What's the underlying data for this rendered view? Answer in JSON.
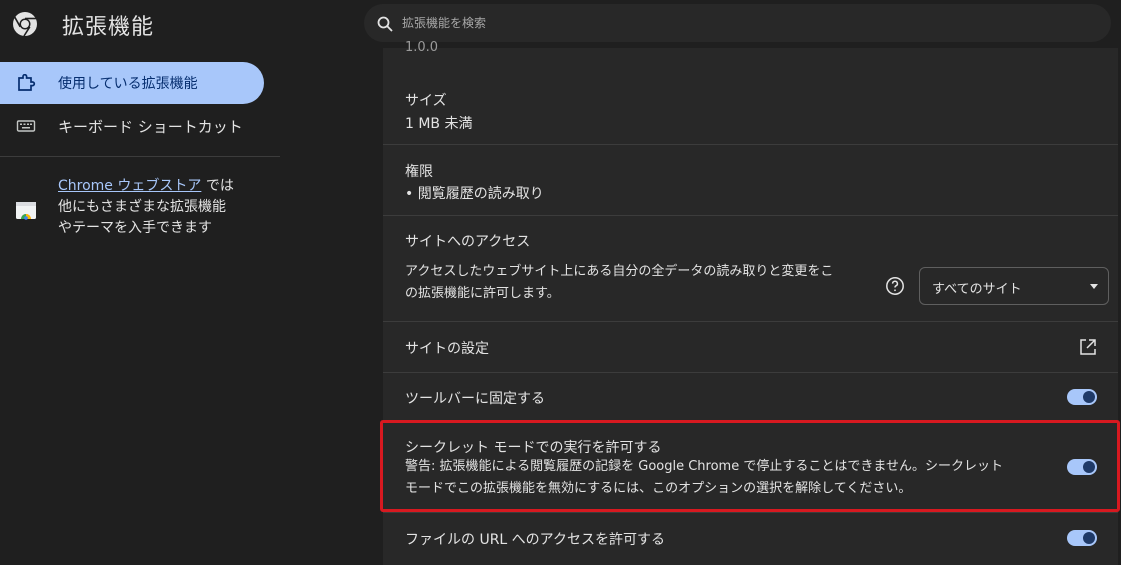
{
  "header": {
    "title": "拡張機能",
    "search_placeholder": "拡張機能を検索"
  },
  "sidebar": {
    "items": [
      {
        "label": "使用している拡張機能",
        "active": true,
        "icon": "extension-icon"
      },
      {
        "label": "キーボード ショートカット",
        "active": false,
        "icon": "keyboard-icon"
      }
    ],
    "store": {
      "link_text": "Chrome ウェブストア",
      "line1_suffix": " では",
      "line2": "他にもさまざまな拡張機能",
      "line3": "やテーマを入手できます",
      "icon": "chrome-web-store-icon"
    }
  },
  "details": {
    "version_fragment": "1.0.0",
    "size_label": "サイズ",
    "size_value": "1 MB 未満",
    "permissions_label": "権限",
    "permissions_item": "• 閲覧履歴の読み取り",
    "site_access_label": "サイトへのアクセス",
    "site_access_desc_line1": "アクセスしたウェブサイト上にある自分の全データの読み取りと変更をこ",
    "site_access_desc_line2": "の拡張機能に許可します。",
    "site_access_select": "すべてのサイト",
    "site_settings_label": "サイトの設定",
    "pin_label": "ツールバーに固定する",
    "incognito_label": "シークレット モードでの実行を許可する",
    "incognito_warning_line1": "警告: 拡張機能による閲覧履歴の記録を Google Chrome で停止することはできません。シークレット",
    "incognito_warning_line2": "モードでこの拡張機能を無効にするには、このオプションの選択を解除してください。",
    "file_url_label": "ファイルの URL へのアクセスを許可する"
  },
  "toggles": {
    "pin": true,
    "incognito": true,
    "file_url": true
  },
  "colors": {
    "accent": "#a8c7fa",
    "background": "#1f1f1f",
    "panel": "#282828",
    "highlight_box": "#d71920"
  }
}
